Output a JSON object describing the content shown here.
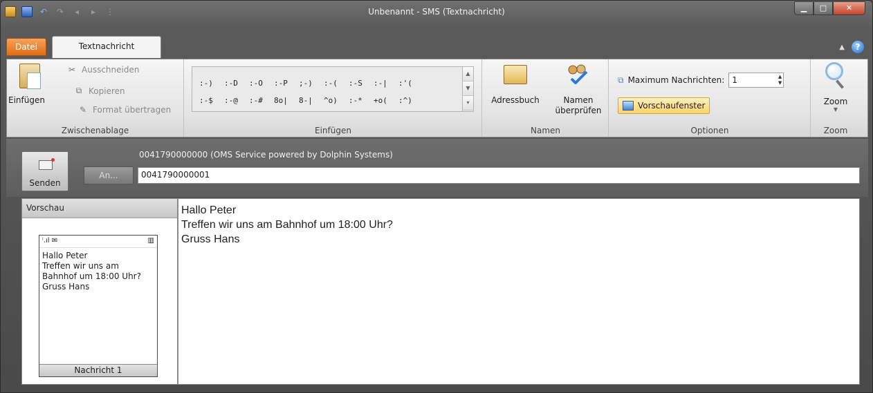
{
  "window": {
    "title": "Unbenannt - SMS (Textnachricht)",
    "controls": [
      "minimize",
      "maximize",
      "close"
    ]
  },
  "quick_access": {
    "icons": [
      "app-icon",
      "save-icon",
      "undo-icon",
      "redo-icon",
      "back-icon",
      "forward-icon",
      "customize-icon"
    ]
  },
  "tabs": {
    "file": "Datei",
    "active": "Textnachricht"
  },
  "ribbon": {
    "clipboard": {
      "paste": "Einfügen",
      "cut": "Ausschneiden",
      "copy": "Kopieren",
      "format_painter": "Format übertragen",
      "group_label": "Zwischenablage"
    },
    "emoticons": {
      "row1": [
        ":-)",
        ":-D",
        ":-O",
        ":-P",
        ";-)",
        ":-(",
        ":-S",
        ":-|",
        ":'("
      ],
      "row2": [
        ":-$",
        ":-@",
        ":-#",
        "8o|",
        "8-|",
        "^o)",
        ":-*",
        "+o(",
        ":^)"
      ],
      "group_label": "Einfügen"
    },
    "names": {
      "address_book": "Adressbuch",
      "check_names": "Namen überprüfen",
      "group_label": "Namen"
    },
    "options": {
      "max_messages_label": "Maximum Nachrichten:",
      "max_messages_value": "1",
      "preview_pane": "Vorschaufenster",
      "group_label": "Optionen"
    },
    "zoom": {
      "label": "Zoom",
      "group_label": "Zoom"
    }
  },
  "header": {
    "send": "Senden",
    "to_button": "An...",
    "from": "0041790000000 (OMS Service powered by Dolphin Systems)",
    "to_value": "0041790000001"
  },
  "preview": {
    "title": "Vorschau",
    "message": "Hallo Peter\nTreffen wir uns am\nBahnhof um 18:00 Uhr?\nGruss Hans",
    "footer": "Nachricht 1"
  },
  "editor": {
    "text": "Hallo Peter\nTreffen wir uns am Bahnhof um 18:00 Uhr?\nGruss Hans"
  },
  "colors": {
    "file_tab": "#e06d14",
    "preview_pane_button": "#ffd36b",
    "frame": "#4a4a4a"
  }
}
